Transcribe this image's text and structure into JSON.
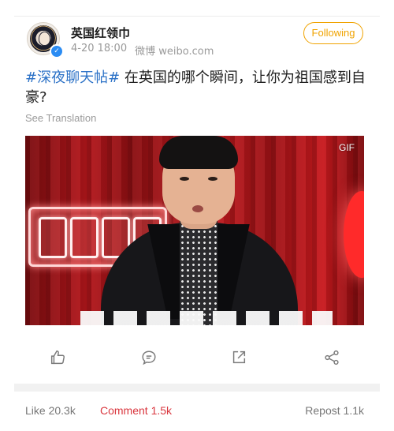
{
  "post": {
    "author": {
      "name": "英国红领巾",
      "verified": true,
      "avatar_icon": "avatar-portrait"
    },
    "meta": {
      "time": "4-20 18:00",
      "source": "微博 weibo.com"
    },
    "follow_label": "Following",
    "hashtag": "#深夜聊天帖#",
    "body": " 在英国的哪个瞬间，让你为祖国感到自豪?",
    "see_translation": "See Translation",
    "media": {
      "badge": "GIF"
    }
  },
  "actions": [
    {
      "name": "like",
      "icon": "thumbs-up-icon"
    },
    {
      "name": "comment",
      "icon": "comment-icon"
    },
    {
      "name": "repost",
      "icon": "share-out-icon"
    },
    {
      "name": "share",
      "icon": "share-nodes-icon"
    }
  ],
  "stats": {
    "like": "Like 20.3k",
    "comment": "Comment 1.5k",
    "repost": "Repost 1.1k"
  },
  "colors": {
    "accent": "#f0a300",
    "hashtag": "#2c72c7",
    "comment_active": "#d9363e",
    "verified": "#2b8cf3"
  }
}
